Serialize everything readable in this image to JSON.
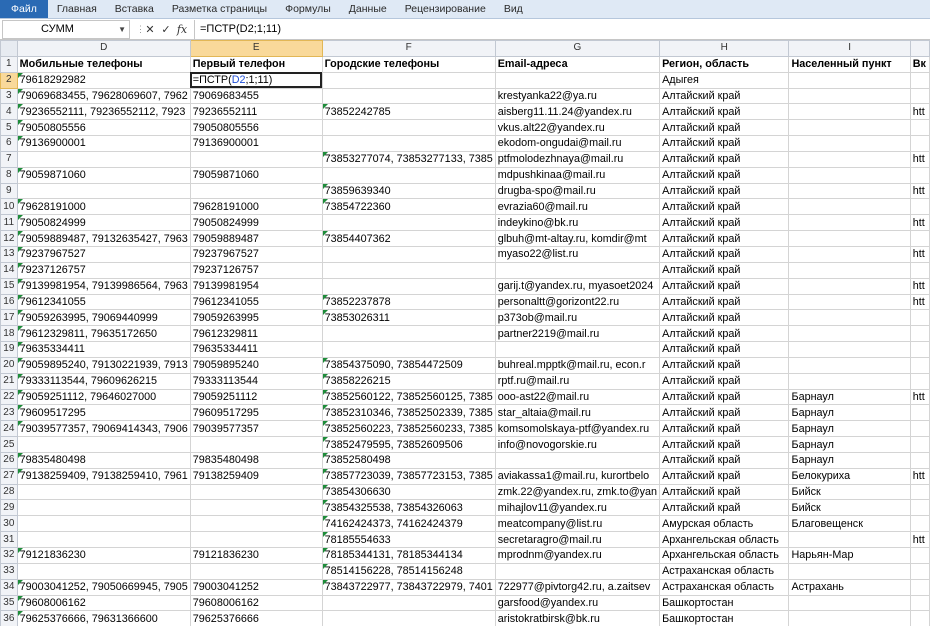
{
  "ribbon": {
    "tabs": [
      "Файл",
      "Главная",
      "Вставка",
      "Разметка страницы",
      "Формулы",
      "Данные",
      "Рецензирование",
      "Вид"
    ]
  },
  "formula_bar": {
    "name_box": "СУММ",
    "cancel_glyph": "✕",
    "enter_glyph": "✓",
    "fx_label": "fx",
    "formula": "=ПСТР(D2;1;11)"
  },
  "sheet": {
    "columns": [
      "D",
      "E",
      "F",
      "G",
      "H",
      "I",
      ""
    ],
    "active_column": "E",
    "active_row": "2",
    "edit_cell": {
      "prefix": "=ПСТР(",
      "ref": "D2",
      "suffix": ";1;11)"
    },
    "header_row": {
      "num": "1",
      "cells": [
        "Мобильные телефоны",
        "Первый телефон",
        "Городские телефоны",
        "Email-адреса",
        "Регион, область",
        "Населенный пункт",
        "Вк"
      ]
    },
    "rows": [
      {
        "num": "2",
        "D": "79618292982",
        "E": "",
        "F": "",
        "G": "",
        "H": "Адыгея",
        "I": "",
        "J": ""
      },
      {
        "num": "3",
        "D": "79069683455, 79628069607, 7962",
        "E": "79069683455",
        "F": "",
        "G": "krestyanka22@ya.ru",
        "H": "Алтайский край",
        "I": "",
        "J": ""
      },
      {
        "num": "4",
        "D": "79236552111, 79236552112, 7923",
        "E": "79236552111",
        "F": "73852242785",
        "G": "aisberg11.11.24@yandex.ru",
        "H": "Алтайский край",
        "I": "",
        "J": "htt"
      },
      {
        "num": "5",
        "D": "79050805556",
        "E": "79050805556",
        "F": "",
        "G": "vkus.alt22@yandex.ru",
        "H": "Алтайский край",
        "I": "",
        "J": ""
      },
      {
        "num": "6",
        "D": "79136900001",
        "E": "79136900001",
        "F": "",
        "G": "ekodom-ongudai@mail.ru",
        "H": "Алтайский край",
        "I": "",
        "J": ""
      },
      {
        "num": "7",
        "D": "",
        "E": "",
        "F": "73853277074, 73853277133, 7385",
        "G": "ptfmolodezhnaya@mail.ru",
        "H": "Алтайский край",
        "I": "",
        "J": "htt"
      },
      {
        "num": "8",
        "D": "79059871060",
        "E": "79059871060",
        "F": "",
        "G": "mdpushkinaa@mail.ru",
        "H": "Алтайский край",
        "I": "",
        "J": ""
      },
      {
        "num": "9",
        "D": "",
        "E": "",
        "F": "73859639340",
        "G": "drugba-spo@mail.ru",
        "H": "Алтайский край",
        "I": "",
        "J": "htt"
      },
      {
        "num": "10",
        "D": "79628191000",
        "E": "79628191000",
        "F": "73854722360",
        "G": "evrazia60@mail.ru",
        "H": "Алтайский край",
        "I": "",
        "J": ""
      },
      {
        "num": "11",
        "D": "79050824999",
        "E": "79050824999",
        "F": "",
        "G": "indeykino@bk.ru",
        "H": "Алтайский край",
        "I": "",
        "J": "htt"
      },
      {
        "num": "12",
        "D": "79059889487, 79132635427, 7963",
        "E": "79059889487",
        "F": "73854407362",
        "G": "glbuh@mt-altay.ru, komdir@mt",
        "H": "Алтайский край",
        "I": "",
        "J": ""
      },
      {
        "num": "13",
        "D": "79237967527",
        "E": "79237967527",
        "F": "",
        "G": "myaso22@list.ru",
        "H": "Алтайский край",
        "I": "",
        "J": "htt"
      },
      {
        "num": "14",
        "D": "79237126757",
        "E": "79237126757",
        "F": "",
        "G": "",
        "H": "Алтайский край",
        "I": "",
        "J": ""
      },
      {
        "num": "15",
        "D": "79139981954, 79139986564, 7963",
        "E": "79139981954",
        "F": "",
        "G": "garij.t@yandex.ru, myasoet2024",
        "H": "Алтайский край",
        "I": "",
        "J": "htt"
      },
      {
        "num": "16",
        "D": "79612341055",
        "E": "79612341055",
        "F": "73852237878",
        "G": "personaltt@gorizont22.ru",
        "H": "Алтайский край",
        "I": "",
        "J": "htt"
      },
      {
        "num": "17",
        "D": "79059263995, 79069440999",
        "E": "79059263995",
        "F": "73853026311",
        "G": "p373ob@mail.ru",
        "H": "Алтайский край",
        "I": "",
        "J": ""
      },
      {
        "num": "18",
        "D": "79612329811, 79635172650",
        "E": "79612329811",
        "F": "",
        "G": "partner2219@mail.ru",
        "H": "Алтайский край",
        "I": "",
        "J": ""
      },
      {
        "num": "19",
        "D": "79635334411",
        "E": "79635334411",
        "F": "",
        "G": "",
        "H": "Алтайский край",
        "I": "",
        "J": ""
      },
      {
        "num": "20",
        "D": "79059895240, 79130221939, 7913",
        "E": "79059895240",
        "F": "73854375090, 73854472509",
        "G": "buhreal.mpptk@mail.ru, econ.r",
        "H": "Алтайский край",
        "I": "",
        "J": ""
      },
      {
        "num": "21",
        "D": "79333113544, 79609626215",
        "E": "79333113544",
        "F": "73858226215",
        "G": "rptf.ru@mail.ru",
        "H": "Алтайский край",
        "I": "",
        "J": ""
      },
      {
        "num": "22",
        "D": "79059251112, 79646027000",
        "E": "79059251112",
        "F": "73852560122, 73852560125, 7385",
        "G": "ooo-ast22@mail.ru",
        "H": "Алтайский край",
        "I": "Барнаул",
        "J": "htt"
      },
      {
        "num": "23",
        "D": "79609517295",
        "E": "79609517295",
        "F": "73852310346, 73852502339, 7385",
        "G": "star_altaia@mail.ru",
        "H": "Алтайский край",
        "I": "Барнаул",
        "J": ""
      },
      {
        "num": "24",
        "D": "79039577357, 79069414343, 7906",
        "E": "79039577357",
        "F": "73852560223, 73852560233, 7385",
        "G": "komsomolskaya-ptf@yandex.ru",
        "H": "Алтайский край",
        "I": "Барнаул",
        "J": ""
      },
      {
        "num": "25",
        "D": "",
        "E": "",
        "F": "73852479595, 73852609506",
        "G": "info@novogorskie.ru",
        "H": "Алтайский край",
        "I": "Барнаул",
        "J": ""
      },
      {
        "num": "26",
        "D": "79835480498",
        "E": "79835480498",
        "F": "73852580498",
        "G": "",
        "H": "Алтайский край",
        "I": "Барнаул",
        "J": ""
      },
      {
        "num": "27",
        "D": "79138259409, 79138259410, 7961",
        "E": "79138259409",
        "F": "73857723039, 73857723153, 7385",
        "G": "aviakassa1@mail.ru, kurortbelo",
        "H": "Алтайский край",
        "I": "Белокуриха",
        "J": "htt"
      },
      {
        "num": "28",
        "D": "",
        "E": "",
        "F": "73854306630",
        "G": "zmk.22@yandex.ru, zmk.to@yan",
        "H": "Алтайский край",
        "I": "Бийск",
        "J": ""
      },
      {
        "num": "29",
        "D": "",
        "E": "",
        "F": "73854325538, 73854326063",
        "G": "mihajlov11@yandex.ru",
        "H": "Алтайский край",
        "I": "Бийск",
        "J": ""
      },
      {
        "num": "30",
        "D": "",
        "E": "",
        "F": "74162424373, 74162424379",
        "G": "meatcompany@list.ru",
        "H": "Амурская область",
        "I": "Благовещенск",
        "J": ""
      },
      {
        "num": "31",
        "D": "",
        "E": "",
        "F": "78185554633",
        "G": "secretaragro@mail.ru",
        "H": "Архангельская область",
        "I": "",
        "J": "htt"
      },
      {
        "num": "32",
        "D": "79121836230",
        "E": "79121836230",
        "F": "78185344131, 78185344134",
        "G": "mprodnm@yandex.ru",
        "H": "Архангельская область",
        "I": "Нарьян-Мар",
        "J": ""
      },
      {
        "num": "33",
        "D": "",
        "E": "",
        "F": "78514156228, 78514156248",
        "G": "",
        "H": "Астраханская область",
        "I": "",
        "J": ""
      },
      {
        "num": "34",
        "D": "79003041252, 79050669945, 7905",
        "E": "79003041252",
        "F": "73843722977, 73843722979, 7401",
        "G": "722977@pivtorg42.ru, a.zaitsev",
        "H": "Астраханская область",
        "I": "Астрахань",
        "J": ""
      },
      {
        "num": "35",
        "D": "79608006162",
        "E": "79608006162",
        "F": "",
        "G": "garsfood@yandex.ru",
        "H": "Башкортостан",
        "I": "",
        "J": ""
      },
      {
        "num": "36",
        "D": "79625376666, 79631366600",
        "E": "79625376666",
        "F": "",
        "G": "aristokratbirsk@bk.ru",
        "H": "Башкортостан",
        "I": "",
        "J": ""
      }
    ]
  }
}
